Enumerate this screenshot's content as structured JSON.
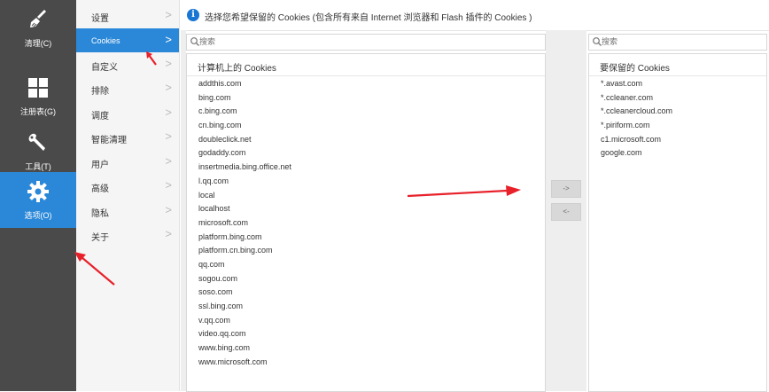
{
  "nav": [
    {
      "label": "清理(C)",
      "icon": "broom-icon",
      "active": false
    },
    {
      "label": "注册表(G)",
      "icon": "registry-grid-icon",
      "active": false
    },
    {
      "label": "工具(T)",
      "icon": "wrench-icon",
      "active": false
    },
    {
      "label": "选项(O)",
      "icon": "gear-icon",
      "active": true
    }
  ],
  "settings_menu": [
    {
      "label": "设置",
      "active": false
    },
    {
      "label": "Cookies",
      "active": true
    },
    {
      "label": "自定义",
      "active": false
    },
    {
      "label": "排除",
      "active": false
    },
    {
      "label": "调度",
      "active": false
    },
    {
      "label": "智能清理",
      "active": false
    },
    {
      "label": "用户",
      "active": false
    },
    {
      "label": "高级",
      "active": false
    },
    {
      "label": "隐私",
      "active": false
    },
    {
      "label": "关于",
      "active": false
    }
  ],
  "chevron": ">",
  "info": {
    "icon": "info-icon",
    "icon_glyph": "i",
    "text": "选择您希望保留的 Cookies (包含所有来自 Internet 浏览器和 Flash 插件的 Cookies )"
  },
  "left_search": {
    "placeholder": "搜索",
    "value": ""
  },
  "right_search": {
    "placeholder": "搜索",
    "value": ""
  },
  "computer_cookies": {
    "title": "计算机上的 Cookies",
    "items": [
      "addthis.com",
      "bing.com",
      "c.bing.com",
      "cn.bing.com",
      "doubleclick.net",
      "godaddy.com",
      "insertmedia.bing.office.net",
      "l.qq.com",
      "local",
      "localhost",
      "microsoft.com",
      "platform.bing.com",
      "platform.cn.bing.com",
      "qq.com",
      "sogou.com",
      "soso.com",
      "ssl.bing.com",
      "v.qq.com",
      "video.qq.com",
      "www.bing.com",
      "www.microsoft.com"
    ]
  },
  "keep_cookies": {
    "title": "要保留的 Cookies",
    "items": [
      "*.avast.com",
      "*.ccleaner.com",
      "*.ccleanercloud.com",
      "*.piriform.com",
      "c1.microsoft.com",
      "google.com"
    ]
  },
  "move_right_label": "->",
  "move_left_label": "<-",
  "colors": {
    "nav_bg": "#4a4a4a",
    "active_blue": "#2b88d8",
    "annotation_red": "#e8202a",
    "info_icon": "#1976d2"
  }
}
